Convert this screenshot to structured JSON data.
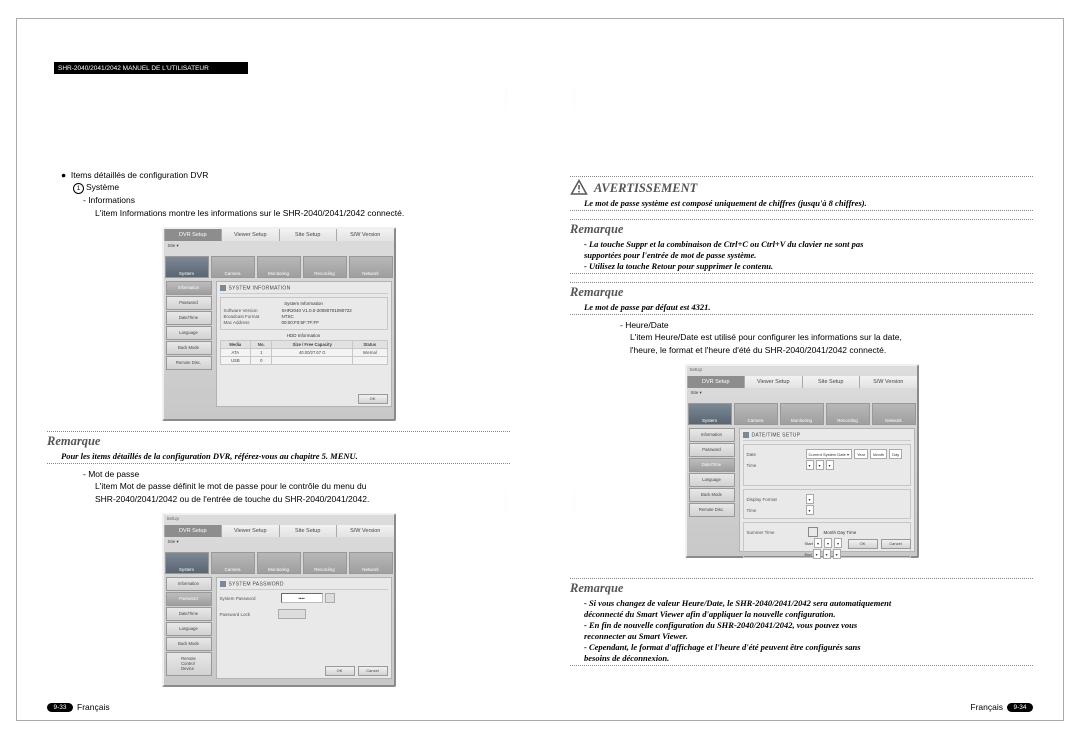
{
  "header": "SHR-2040/2041/2042 MANUEL DE L'UTILISATEUR",
  "left": {
    "bullet_line": "Items détaillés de configuration DVR",
    "sys_label": "Système",
    "info_label": "- Informations",
    "info_desc": "L'item Informations montre les informations sur le SHR-2040/2041/2042 connecté.",
    "rem1_title": "Remarque",
    "rem1_body": "Pour les items détaillés de la configuration DVR, référez-vous au chapitre 5. MENU.",
    "pass_label": "- Mot de passe",
    "pass_l1": "L'item Mot de passe définit le mot de passe pour le contrôle du menu du",
    "pass_l2": "SHR-2040/2041/2042 ou de l'entrée de touche du SHR-2040/2041/2042."
  },
  "right": {
    "avert_title": "AVERTISSEMENT",
    "avert_body": "Le mot de passe système est composé uniquement de chiffres (jusqu'à 8 chiffres).",
    "rem2_title": "Remarque",
    "rem2_l1": "- La touche Suppr et la combinaison de Ctrl+C ou Ctrl+V du clavier ne sont pas",
    "rem2_l1b": "  supportées pour l'entrée de mot de passe système.",
    "rem2_l2": "- Utilisez la touche Retour pour supprimer le contenu.",
    "rem3_title": "Remarque",
    "rem3_body": "Le mot de passe par défaut est 4321.",
    "hd_label": "- Heure/Date",
    "hd_l1": "L'item Heure/Date est utilisé pour configurer les informations sur la date,",
    "hd_l2": "l'heure, le format et l'heure d'été du SHR-2040/2041/2042 connecté.",
    "rem4_title": "Remarque",
    "rem4_l1": "- Si vous changez de valeur Heure/Date, le SHR-2040/2041/2042 sera automatiquement",
    "rem4_l1b": "  déconnecté du Smart Viewer afin d'appliquer la nouvelle configuration.",
    "rem4_l2": "- En fin de nouvelle configuration du SHR-2040/2041/2042, vous pouvez vous",
    "rem4_l2b": "  reconnecter au Smart Viewer.",
    "rem4_l3": "- Cependant, le format d'affichage et l'heure d'été peuvent être configurés sans",
    "rem4_l3b": "  besoins de déconnexion."
  },
  "shot": {
    "tabs": [
      "DVR Setup",
      "Viewer Setup",
      "Site Setup",
      "S/W Version"
    ],
    "icons": [
      "System",
      "Camera",
      "Monitoring",
      "Recording",
      "Network"
    ],
    "side_info": [
      "Information",
      "Password",
      "Date/Time",
      "Language",
      "Back Mode",
      "Remote Disc."
    ],
    "info_title": "SYSTEM INFORMATION",
    "info_box_title": "System Information",
    "info_rows": [
      {
        "k": "Software Version",
        "v": "SHR2040 V1.0.0-20080701090722"
      },
      {
        "k": "Broadcast Format",
        "v": "NTSC"
      },
      {
        "k": "Mac Address",
        "v": "00:00:F0:5F:7F:FF"
      }
    ],
    "hdd_title": "HDD Information",
    "hdd_cols": [
      "Media",
      "No.",
      "Size / Free Capacity",
      "Status"
    ],
    "hdd_r1": [
      "ATA",
      "1",
      "40.00/27.67 G",
      "Internal"
    ],
    "hdd_r2": [
      "USB",
      "0",
      "",
      ""
    ],
    "pass_title": "SYSTEM PASSWORD",
    "pass_row1": "System Password",
    "pass_row2": "Password Lock",
    "date_title": "DATE/TIME SETUP",
    "btn_ok": "OK",
    "btn_ok_cancel": "OK  Cancel"
  },
  "footer": {
    "lang": "Français",
    "page_left": "9-33",
    "page_right": "9-34"
  }
}
